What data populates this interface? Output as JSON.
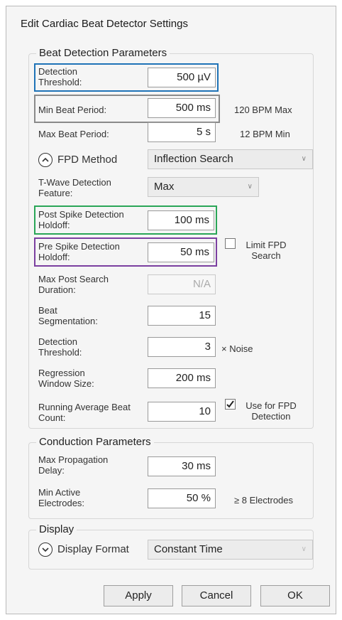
{
  "dialog": {
    "title": "Edit Cardiac Beat Detector Settings"
  },
  "beat_detection": {
    "group_label": "Beat Detection Parameters",
    "detection_threshold": {
      "label": "Detection Threshold:",
      "value": "500 µV",
      "highlight_color": "#1f73b7"
    },
    "min_beat_period": {
      "label": "Min Beat Period:",
      "value": "500 ms",
      "note": "120 BPM Max",
      "highlight_color": "#8a8a8a"
    },
    "max_beat_period": {
      "label": "Max Beat Period:",
      "value": "5 s",
      "note": "12 BPM Min"
    },
    "fpd_method": {
      "label": "FPD Method",
      "value": "Inflection Search",
      "icon": "chevron-up-icon"
    },
    "twave_feature": {
      "label": "T-Wave Detection Feature:",
      "value": "Max"
    },
    "post_spike_holdoff": {
      "label": "Post Spike Detection Holdoff:",
      "value": "100 ms",
      "highlight_color": "#2aa657"
    },
    "pre_spike_holdoff": {
      "label": "Pre Spike Detection Holdoff:",
      "value": "50 ms",
      "highlight_color": "#7b3fa0"
    },
    "limit_fpd_search": {
      "label": "Limit FPD Search",
      "checked": false
    },
    "max_post_search": {
      "label": "Max Post Search Duration:",
      "value": "N/A"
    },
    "beat_segmentation": {
      "label": "Beat Segmentation:",
      "value": "15"
    },
    "detection_threshold_noise": {
      "label": "Detection Threshold:",
      "value": "3",
      "note": "× Noise"
    },
    "regression_window": {
      "label": "Regression Window Size:",
      "value": "200 ms"
    },
    "running_average": {
      "label": "Running Average Beat Count:",
      "value": "10"
    },
    "use_for_fpd": {
      "label": "Use for FPD Detection",
      "checked": true
    }
  },
  "conduction": {
    "group_label": "Conduction Parameters",
    "max_propagation_delay": {
      "label": "Max Propagation Delay:",
      "value": "30 ms"
    },
    "min_active_electrodes": {
      "label": "Min Active Electrodes:",
      "value": "50 %",
      "note": "≥ 8 Electrodes"
    }
  },
  "display": {
    "group_label": "Display",
    "format": {
      "label": "Display Format",
      "value": "Constant Time",
      "icon": "chevron-down-icon"
    }
  },
  "buttons": {
    "apply": "Apply",
    "cancel": "Cancel",
    "ok": "OK"
  }
}
